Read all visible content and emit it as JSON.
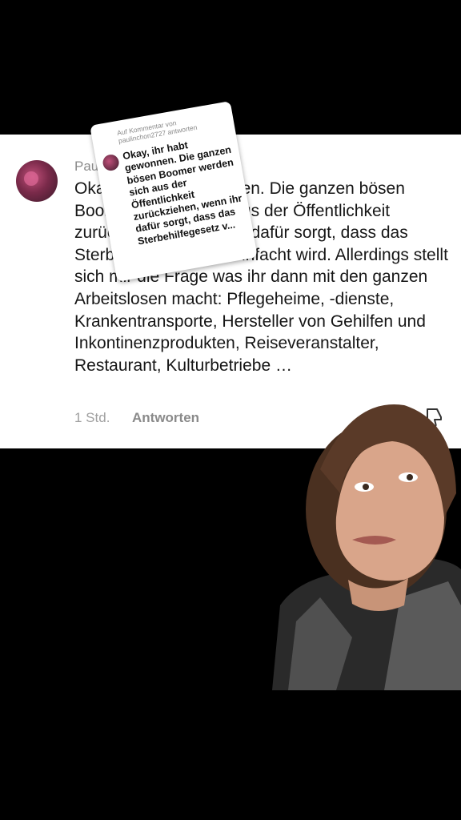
{
  "comment": {
    "username": "Paul.",
    "text": "Okay, ihr habt gewonnen. Die ganzen bösen Boomer werden sich aus der Öffentlichkeit zurückziehen, wenn ihr dafür sorgt, dass das Sterbehilfegesetz vereinfacht wird. Allerdings stellt sich mir die Frage was ihr dann mit den ganzen Arbeitslosen macht: Pflegeheime, -dienste, Krankentransporte, Hersteller von Gehilfen und Inkontinenzprodukten, Reiseveranstalter, Restaurant, Kulturbetriebe …",
    "time": "1 Std.",
    "reply_label": "Antworten",
    "dislike_icon": "thumbs-down-icon"
  },
  "sticker": {
    "header": "Auf Kommentar von paulinchon2727 antworten",
    "text": "Okay, ihr habt gewonnen. Die ganzen bösen Boomer werden sich aus der Öffentlichkeit zurückziehen, wenn ihr dafür sorgt, dass das Sterbehilfegesetz v..."
  },
  "colors": {
    "background": "#000000",
    "card": "#ffffff",
    "text": "#161616",
    "muted": "#8a8a8a"
  }
}
